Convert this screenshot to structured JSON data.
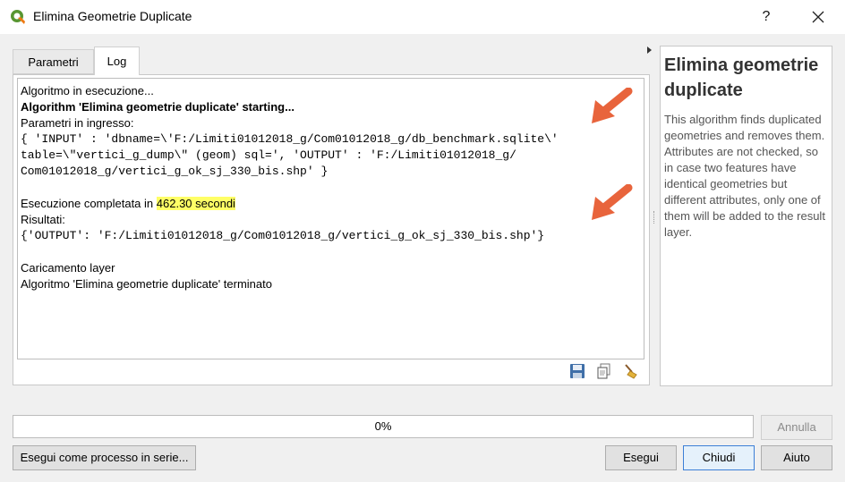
{
  "window": {
    "title": "Elimina Geometrie Duplicate",
    "help_button": "?",
    "close_icon": "close-icon"
  },
  "tabs": [
    {
      "label": "Parametri",
      "active": false
    },
    {
      "label": "Log",
      "active": true
    }
  ],
  "log": {
    "lines": [
      "Algoritmo in esecuzione...",
      "Algorithm 'Elimina geometrie duplicate' starting...",
      "Parametri in ingresso:",
      "{ 'INPUT' : 'dbname=\\'F:/Limiti01012018_g/Com01012018_g/db_benchmark.sqlite\\'",
      "table=\\\"vertici_g_dump\\\" (geom) sql=', 'OUTPUT' : 'F:/Limiti01012018_g/",
      "Com01012018_g/vertici_g_ok_sj_330_bis.shp' }",
      "Esecuzione completata in ",
      "462.30 secondi",
      "Risultati:",
      "{'OUTPUT': 'F:/Limiti01012018_g/Com01012018_g/vertici_g_ok_sj_330_bis.shp'}",
      "Caricamento layer",
      "Algoritmo 'Elimina geometrie duplicate' terminato"
    ],
    "highlight_color": "#ffff66",
    "arrow_color": "#e8643c"
  },
  "help": {
    "title": "Elimina geometrie duplicate",
    "description": "This algorithm finds duplicated geometries and removes them. Attributes are not checked, so in case two features have identical geometries but different attributes, only one of them will be added to the result layer."
  },
  "progress": {
    "value": 0,
    "text": "0%"
  },
  "buttons": {
    "cancel": "Annulla",
    "batch": "Esegui come processo in serie...",
    "run": "Esegui",
    "close": "Chiudi",
    "help": "Aiuto"
  },
  "icons": {
    "save": "save-icon",
    "copy": "copy-icon",
    "clear": "broom-icon"
  }
}
